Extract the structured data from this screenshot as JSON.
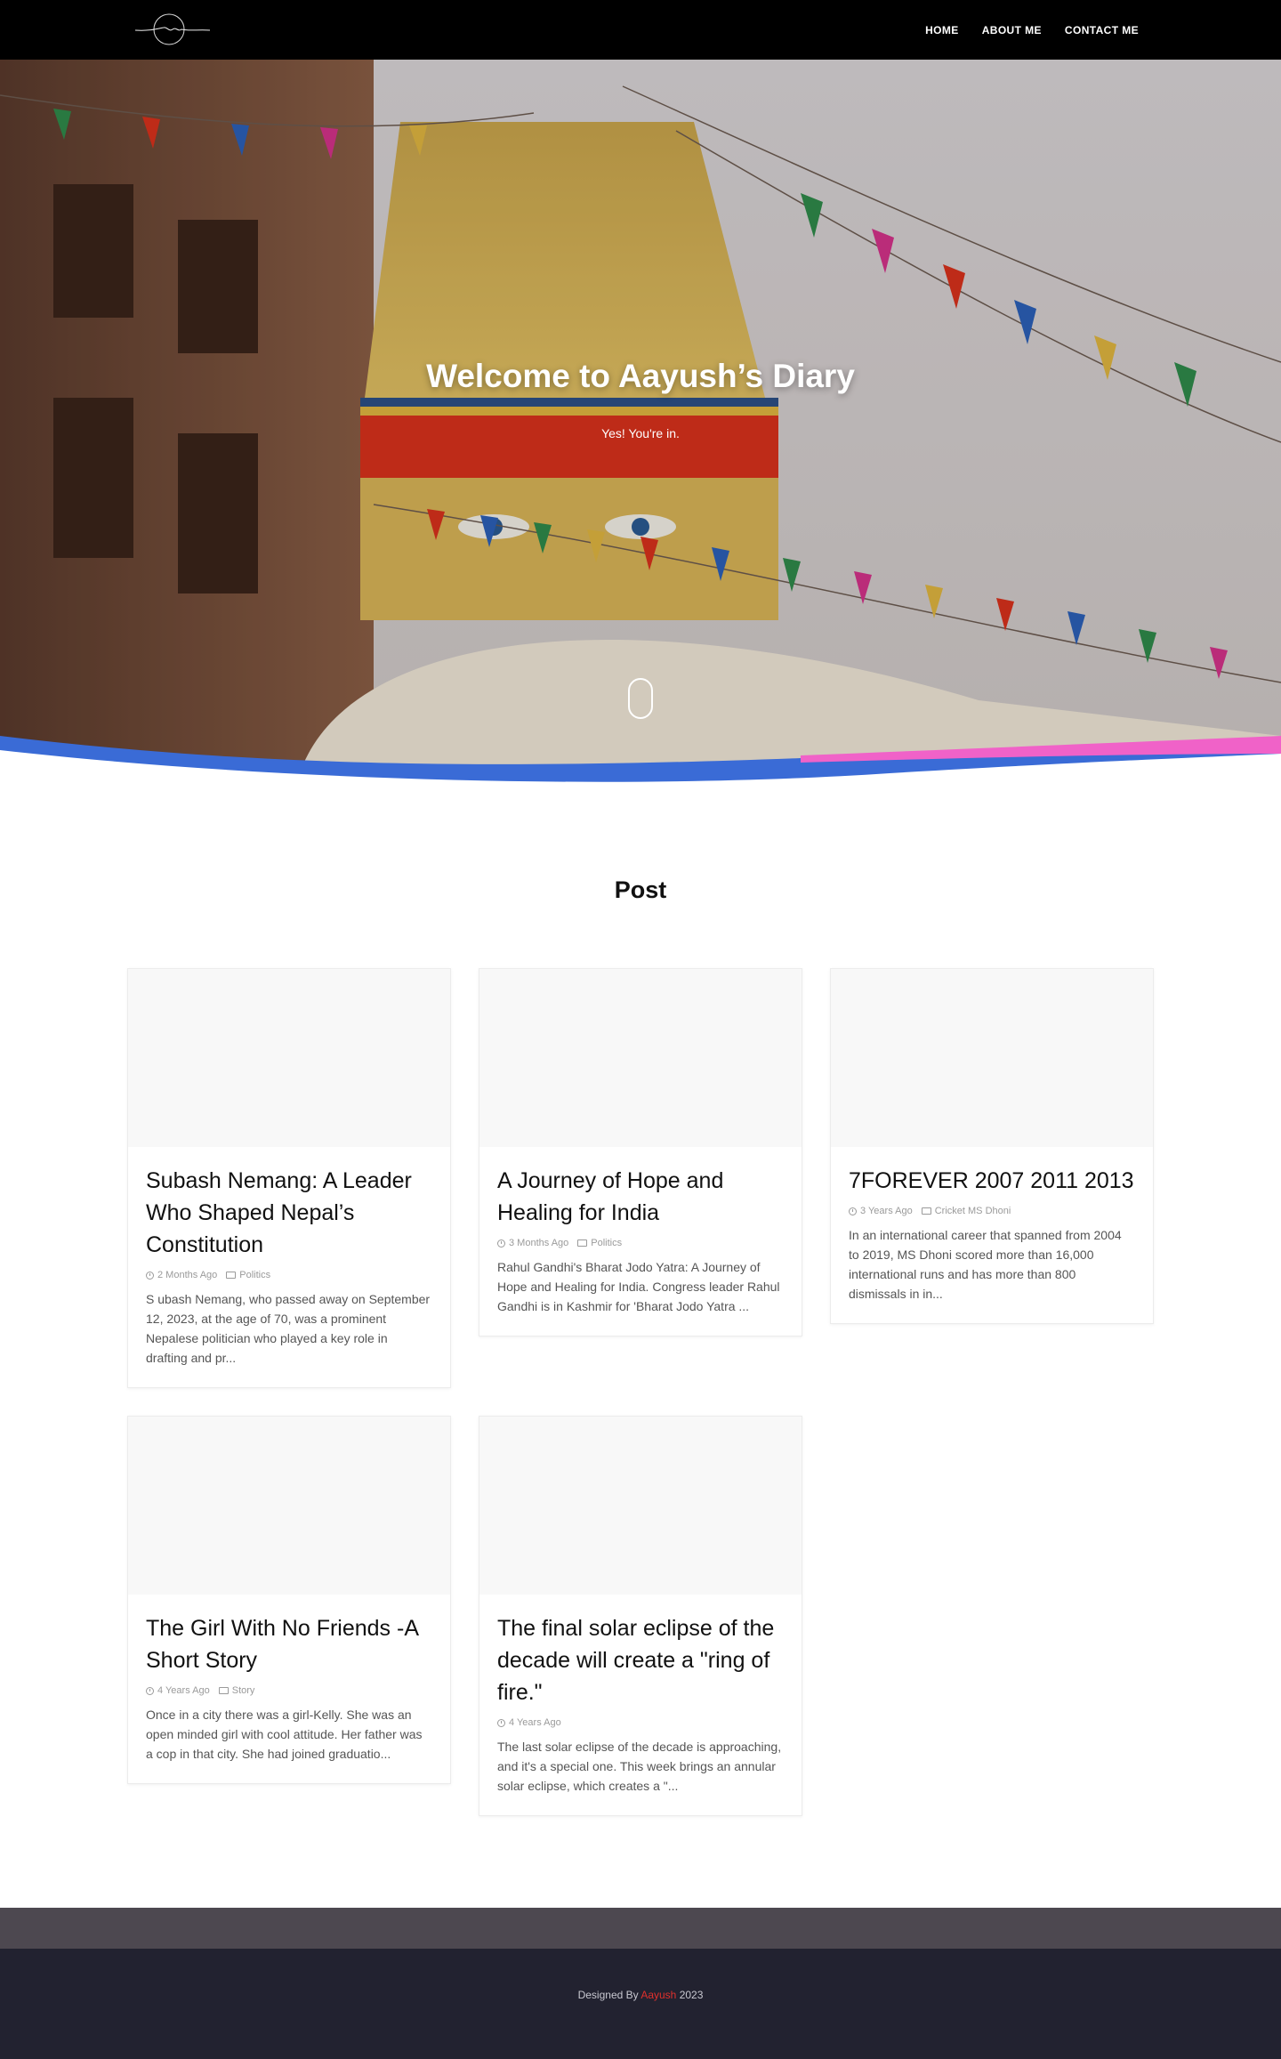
{
  "nav": {
    "logo_icon": "signature-logo",
    "links": [
      "HOME",
      "ABOUT ME",
      "CONTACT ME"
    ]
  },
  "hero": {
    "title": "Welcome to Aayush’s Diary",
    "subtitle": "Yes! You're in.",
    "scroll_icon": "mouse-scroll-icon"
  },
  "posts": {
    "heading": "Post",
    "items": [
      {
        "title": "Subash Nemang: A Leader Who Shaped Nepal’s Constitution",
        "date": "2 Months Ago",
        "category": "Politics",
        "excerpt": "S ubash Nemang, who passed away on September 12, 2023, at the age of 70, was a prominent Nepalese politician who played a key role in drafting and pr..."
      },
      {
        "title": "A Journey of Hope and Healing for India",
        "date": "3 Months Ago",
        "category": "Politics",
        "excerpt": "Rahul Gandhi's Bharat Jodo Yatra: A Journey of Hope and Healing for India. Congress leader Rahul Gandhi is in Kashmir for 'Bharat Jodo Yatra ..."
      },
      {
        "title": "7FOREVER 2007 2011 2013",
        "date": "3 Years Ago",
        "category": "Cricket MS Dhoni",
        "excerpt": "In an international career that spanned from 2004 to 2019, MS Dhoni scored more than 16,000 international runs and has more than 800 dismissals in in..."
      },
      {
        "title": "The Girl With No Friends -A Short Story",
        "date": "4 Years Ago",
        "category": "Story",
        "excerpt": "Once in a city there was a girl-Kelly. She was an open minded girl with cool attitude. Her father was a cop in that city. She had joined graduatio..."
      },
      {
        "title": "The final solar eclipse of the decade will create a \"ring of fire.\"",
        "date": "4 Years Ago",
        "category": "",
        "excerpt": "The last solar eclipse of the decade is approaching, and it's a special one. This week brings an annular solar eclipse, which creates a \"..."
      }
    ]
  },
  "footer": {
    "prefix": "Designed By",
    "brand": "Aayush",
    "year": "2023"
  },
  "colors": {
    "nav_bg": "#000000",
    "footer_bg": "#222230",
    "footer_top_bg": "#4d4850",
    "brand_accent": "#e0302c",
    "wave_blue": "#3a6bd6",
    "wave_pink": "#f062c8"
  }
}
